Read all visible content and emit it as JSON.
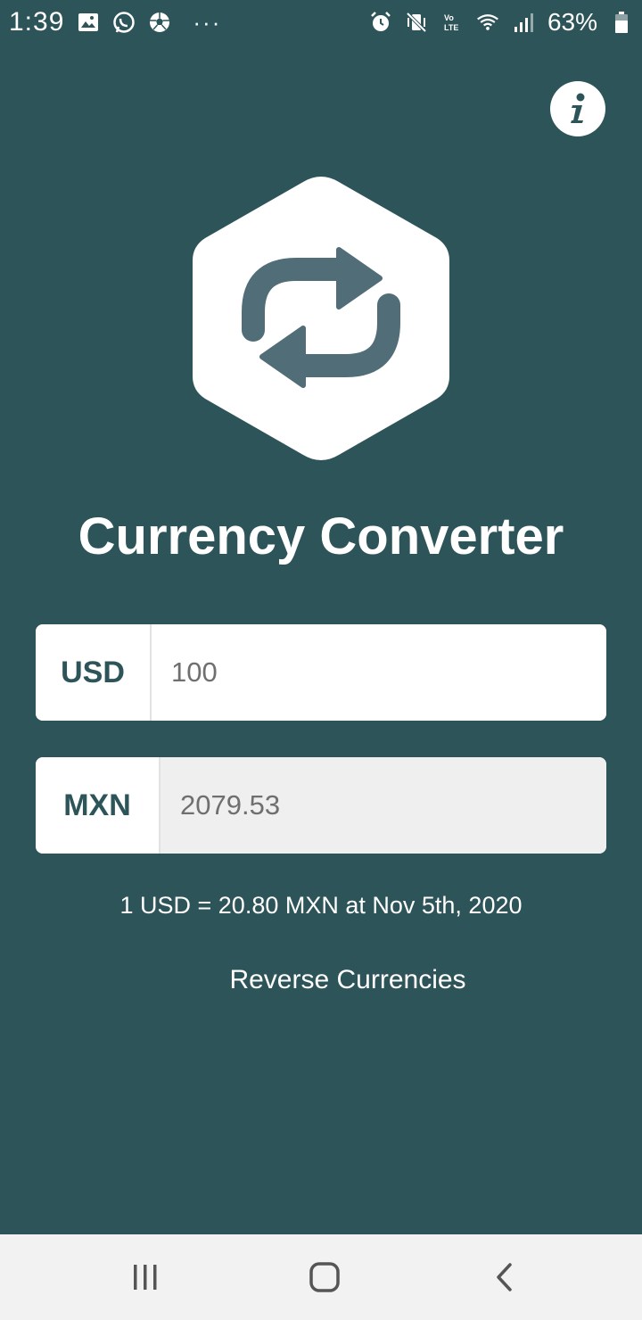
{
  "status_bar": {
    "time": "1:39",
    "battery": "63%",
    "more": "···"
  },
  "app": {
    "title": "Currency Converter"
  },
  "converter": {
    "from_code": "USD",
    "from_value": "100",
    "to_code": "MXN",
    "to_value": "2079.53",
    "rate_text": "1 USD = 20.80 MXN at Nov 5th, 2020",
    "reverse_label": "Reverse Currencies"
  },
  "colors": {
    "background": "#2c5459",
    "logo_arrows": "#506d78",
    "nav_bar": "#f2f2f2"
  },
  "icons": {
    "info": "info-icon",
    "logo": "swap-arrows-icon",
    "recents": "recents-icon",
    "home": "home-icon",
    "back": "back-icon"
  }
}
